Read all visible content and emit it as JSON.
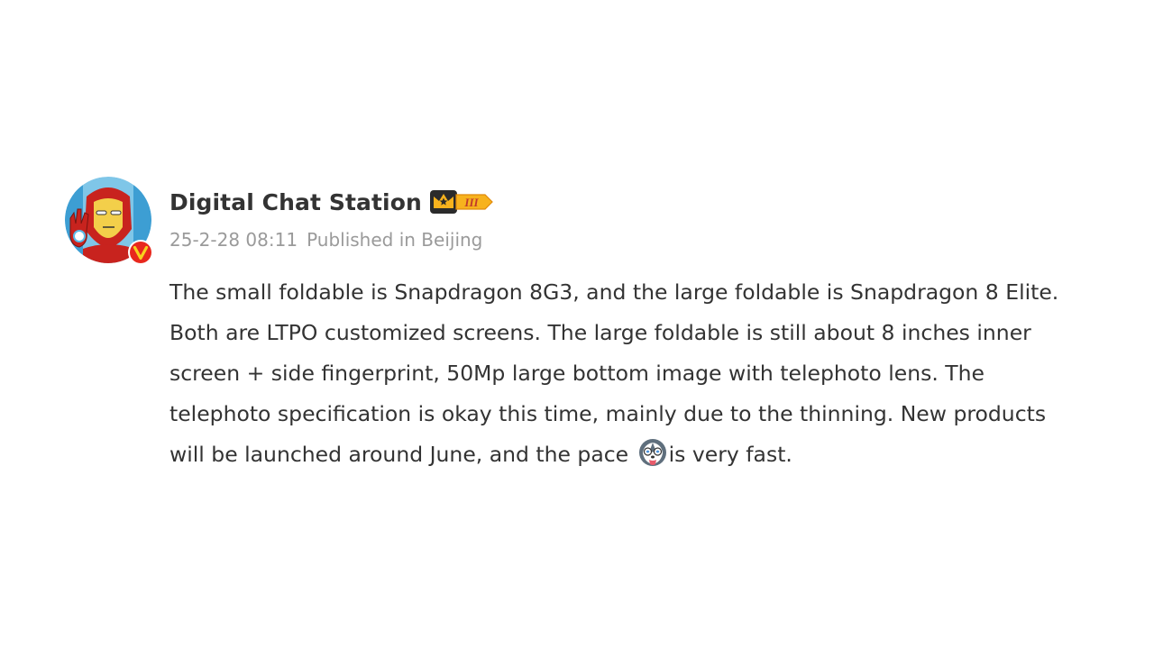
{
  "post": {
    "author": {
      "name": "Digital Chat Station",
      "avatar_icon": "iron-man-avatar-icon",
      "verified_icon": "verified-v-badge-icon",
      "member_badge_icon": "crown-member-level-badge-icon",
      "member_badge_level": "III"
    },
    "meta": {
      "time": "25-2-28 08:11",
      "location": "Published in Beijing"
    },
    "text_before_emoji": "The small foldable is Snapdragon 8G3, and the large foldable is Snapdragon 8 Elite. Both are LTPO customized screens. The large foldable is still about 8 inches inner screen + side fingerprint, 50Mp large bottom image with telephoto lens. The telephoto specification is okay this time, mainly due to the thinning. New products will be launched around June, and the pace",
    "emoji_icon": "husky-dog-emoji-icon",
    "text_after_emoji": "is very fast."
  },
  "colors": {
    "text": "#333333",
    "meta_text": "#9a9a9a",
    "verified_badge": "#e8281d",
    "member_badge_gold": "#f7b21d"
  }
}
